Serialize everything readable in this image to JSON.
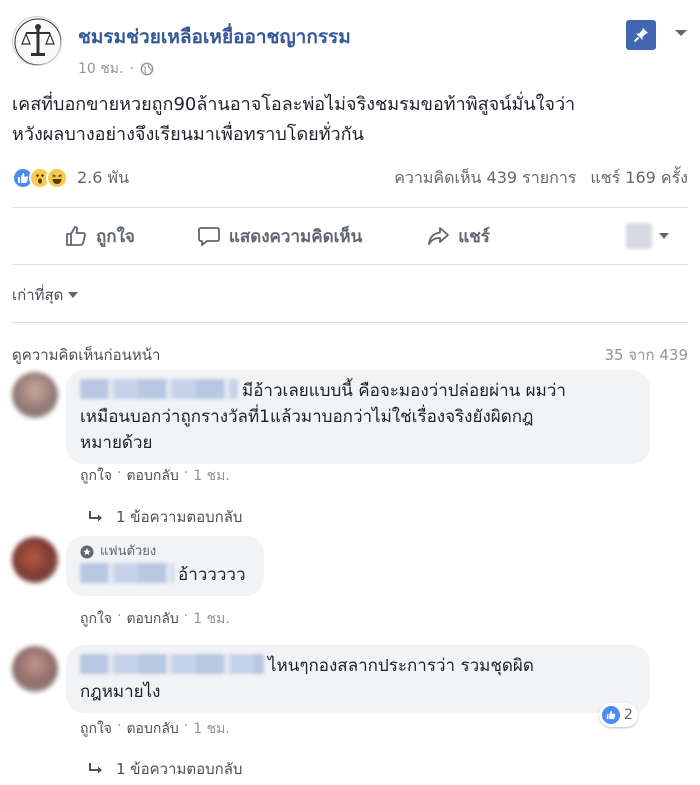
{
  "post": {
    "page_name": "ชมรมช่วยเหลือเหยื่ออาชญากรรม",
    "time": "10 ชม.",
    "separator": "·",
    "text_line1": "เคสที่บอกขายหวยถูก90ล้านอาจโอละพ่อไม่จริงชมรมขอท้าพิสูจน์มั่นใจว่า",
    "text_line2": "หวังผลบางอย่างจึงเรียนมาเพื่อทราบโดยทั่วกัน",
    "icons": [
      "page-logo-icon",
      "globe-icon",
      "pin-icon",
      "caret-down-icon"
    ]
  },
  "reactions": {
    "count": "2.6 พัน",
    "types": [
      "like",
      "wow",
      "haha"
    ],
    "comments": "ความคิดเห็น 439 รายการ",
    "shares": "แชร์ 169 ครั้ง"
  },
  "actions": {
    "like": "ถูกใจ",
    "comment": "แสดงความคิดเห็น",
    "share": "แชร์"
  },
  "sort": {
    "label": "เก่าที่สุด"
  },
  "comments_header": {
    "view_previous": "ดูความคิดเห็นก่อนหน้า",
    "count": "35 จาก 439"
  },
  "comments": [
    {
      "text_line1": "มีอ้าวเลยแบบนี้ คือจะมองว่าปล่อยผ่าน ผมว่า",
      "text_line2": "เหมือนบอกว่าถูกรางวัลที่1แล้วมาบอกว่าไม่ใช่เรื่องจริงยังผิดกฎ",
      "text_line3": "หมายด้วย",
      "like": "ถูกใจ",
      "reply": "ตอบกลับ",
      "time": "1 ชม.",
      "replies": "1 ข้อความตอบกลับ"
    },
    {
      "badge": "แฟนตัวยง",
      "text": "อ้าววววว",
      "like": "ถูกใจ",
      "reply": "ตอบกลับ",
      "time": "1 ชม."
    },
    {
      "text_line1": "ไหนๆกองสลากประการว่า รวมชุดผิด",
      "text_line2": "กฎหมายไง",
      "like": "ถูกใจ",
      "reply": "ตอบกลับ",
      "time": "1 ชม.",
      "like_count": "2",
      "replies": "1 ข้อความตอบกลับ"
    }
  ],
  "colors": {
    "link_blue": "#365899",
    "fb_blue": "#4267b2",
    "meta_gray": "#90949c",
    "bubble_bg": "#f2f3f5"
  }
}
